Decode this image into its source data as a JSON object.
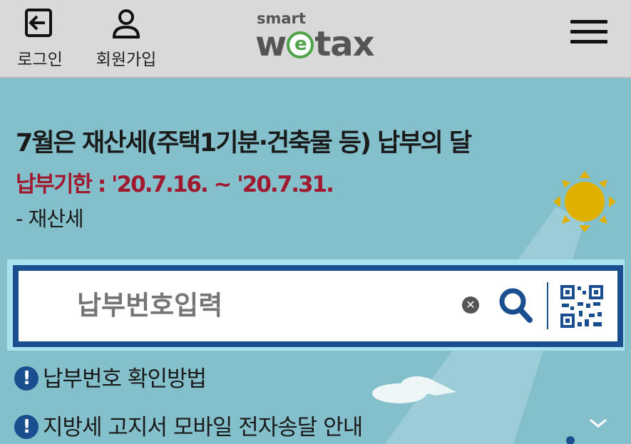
{
  "header": {
    "login_label": "로그인",
    "signup_label": "회원가입",
    "logo_small": "smart",
    "logo_w": "w",
    "logo_e": "e",
    "logo_rest": "tax"
  },
  "main": {
    "headline": "7월은 재산세(주택1기분·건축물 등) 납부의 달",
    "deadline": "납부기한 : '20.7.16. ~ '20.7.31.",
    "tax_type": "- 재산세"
  },
  "search": {
    "placeholder": "납부번호입력",
    "value": ""
  },
  "links": {
    "item1": "납부번호 확인방법",
    "item2": "지방세 고지서 모바일 전자송달 안내",
    "bullet": "!"
  },
  "colors": {
    "background": "#84c0cc",
    "header": "#d9d9d9",
    "accent_blue": "#1a4f8f",
    "deadline_red": "#a0192f",
    "logo_green": "#4fa44a",
    "sun": "#e0b000"
  },
  "icons": [
    "login-icon",
    "person-icon",
    "hamburger-menu-icon",
    "sun-icon",
    "clear-icon",
    "search-icon",
    "qr-code-icon",
    "exclamation-icon",
    "chevron-down-icon"
  ]
}
